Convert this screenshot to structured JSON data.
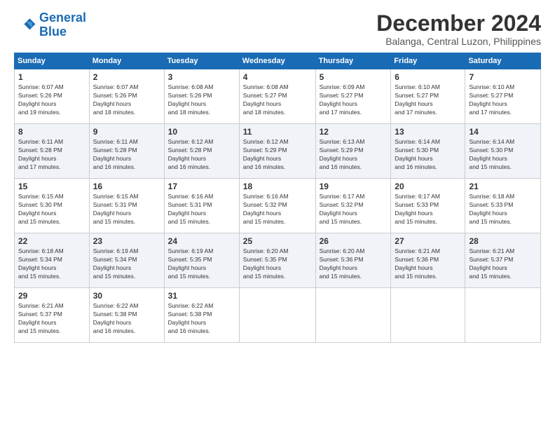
{
  "logo": {
    "line1": "General",
    "line2": "Blue"
  },
  "title": "December 2024",
  "location": "Balanga, Central Luzon, Philippines",
  "days_of_week": [
    "Sunday",
    "Monday",
    "Tuesday",
    "Wednesday",
    "Thursday",
    "Friday",
    "Saturday"
  ],
  "weeks": [
    [
      {
        "day": "1",
        "sunrise": "6:07 AM",
        "sunset": "5:26 PM",
        "daylight": "11 hours and 19 minutes."
      },
      {
        "day": "2",
        "sunrise": "6:07 AM",
        "sunset": "5:26 PM",
        "daylight": "11 hours and 18 minutes."
      },
      {
        "day": "3",
        "sunrise": "6:08 AM",
        "sunset": "5:26 PM",
        "daylight": "11 hours and 18 minutes."
      },
      {
        "day": "4",
        "sunrise": "6:08 AM",
        "sunset": "5:27 PM",
        "daylight": "11 hours and 18 minutes."
      },
      {
        "day": "5",
        "sunrise": "6:09 AM",
        "sunset": "5:27 PM",
        "daylight": "11 hours and 17 minutes."
      },
      {
        "day": "6",
        "sunrise": "6:10 AM",
        "sunset": "5:27 PM",
        "daylight": "11 hours and 17 minutes."
      },
      {
        "day": "7",
        "sunrise": "6:10 AM",
        "sunset": "5:27 PM",
        "daylight": "11 hours and 17 minutes."
      }
    ],
    [
      {
        "day": "8",
        "sunrise": "6:11 AM",
        "sunset": "5:28 PM",
        "daylight": "11 hours and 17 minutes."
      },
      {
        "day": "9",
        "sunrise": "6:11 AM",
        "sunset": "5:28 PM",
        "daylight": "11 hours and 16 minutes."
      },
      {
        "day": "10",
        "sunrise": "6:12 AM",
        "sunset": "5:28 PM",
        "daylight": "11 hours and 16 minutes."
      },
      {
        "day": "11",
        "sunrise": "6:12 AM",
        "sunset": "5:29 PM",
        "daylight": "11 hours and 16 minutes."
      },
      {
        "day": "12",
        "sunrise": "6:13 AM",
        "sunset": "5:29 PM",
        "daylight": "11 hours and 16 minutes."
      },
      {
        "day": "13",
        "sunrise": "6:14 AM",
        "sunset": "5:30 PM",
        "daylight": "11 hours and 16 minutes."
      },
      {
        "day": "14",
        "sunrise": "6:14 AM",
        "sunset": "5:30 PM",
        "daylight": "11 hours and 15 minutes."
      }
    ],
    [
      {
        "day": "15",
        "sunrise": "6:15 AM",
        "sunset": "5:30 PM",
        "daylight": "11 hours and 15 minutes."
      },
      {
        "day": "16",
        "sunrise": "6:15 AM",
        "sunset": "5:31 PM",
        "daylight": "11 hours and 15 minutes."
      },
      {
        "day": "17",
        "sunrise": "6:16 AM",
        "sunset": "5:31 PM",
        "daylight": "11 hours and 15 minutes."
      },
      {
        "day": "18",
        "sunrise": "6:16 AM",
        "sunset": "5:32 PM",
        "daylight": "11 hours and 15 minutes."
      },
      {
        "day": "19",
        "sunrise": "6:17 AM",
        "sunset": "5:32 PM",
        "daylight": "11 hours and 15 minutes."
      },
      {
        "day": "20",
        "sunrise": "6:17 AM",
        "sunset": "5:33 PM",
        "daylight": "11 hours and 15 minutes."
      },
      {
        "day": "21",
        "sunrise": "6:18 AM",
        "sunset": "5:33 PM",
        "daylight": "11 hours and 15 minutes."
      }
    ],
    [
      {
        "day": "22",
        "sunrise": "6:18 AM",
        "sunset": "5:34 PM",
        "daylight": "11 hours and 15 minutes."
      },
      {
        "day": "23",
        "sunrise": "6:19 AM",
        "sunset": "5:34 PM",
        "daylight": "11 hours and 15 minutes."
      },
      {
        "day": "24",
        "sunrise": "6:19 AM",
        "sunset": "5:35 PM",
        "daylight": "11 hours and 15 minutes."
      },
      {
        "day": "25",
        "sunrise": "6:20 AM",
        "sunset": "5:35 PM",
        "daylight": "11 hours and 15 minutes."
      },
      {
        "day": "26",
        "sunrise": "6:20 AM",
        "sunset": "5:36 PM",
        "daylight": "11 hours and 15 minutes."
      },
      {
        "day": "27",
        "sunrise": "6:21 AM",
        "sunset": "5:36 PM",
        "daylight": "11 hours and 15 minutes."
      },
      {
        "day": "28",
        "sunrise": "6:21 AM",
        "sunset": "5:37 PM",
        "daylight": "11 hours and 15 minutes."
      }
    ],
    [
      {
        "day": "29",
        "sunrise": "6:21 AM",
        "sunset": "5:37 PM",
        "daylight": "11 hours and 15 minutes."
      },
      {
        "day": "30",
        "sunrise": "6:22 AM",
        "sunset": "5:38 PM",
        "daylight": "11 hours and 16 minutes."
      },
      {
        "day": "31",
        "sunrise": "6:22 AM",
        "sunset": "5:38 PM",
        "daylight": "11 hours and 16 minutes."
      },
      null,
      null,
      null,
      null
    ]
  ]
}
